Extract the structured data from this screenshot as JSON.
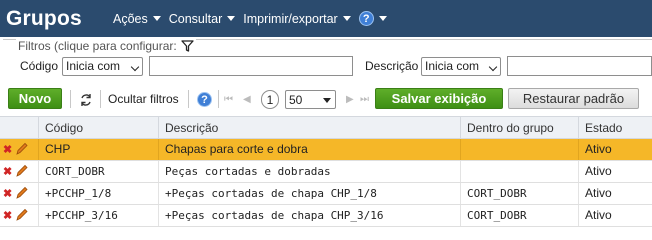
{
  "header": {
    "title": "Grupos",
    "menu": [
      {
        "label": "Ações"
      },
      {
        "label": "Consultar"
      },
      {
        "label": "Imprimir/exportar"
      }
    ],
    "help_icon": "?",
    "background_color": "#2b4b6e"
  },
  "filters": {
    "legend": "Filtros (clique para configurar:",
    "codigo_label": "Código",
    "codigo_operator": "Inicia com",
    "codigo_value": "",
    "descricao_label": "Descrição",
    "descricao_operator": "Inicia com",
    "descricao_value": ""
  },
  "toolbar": {
    "new_label": "Novo",
    "hide_filters_label": "Ocultar filtros",
    "help_icon": "?",
    "page_number": "1",
    "page_size": "50",
    "save_view_label": "Salvar exibição",
    "restore_default_label": "Restaurar padrão"
  },
  "table": {
    "columns": [
      "Código",
      "Descrição",
      "Dentro do grupo",
      "Estado"
    ],
    "rows": [
      {
        "codigo": "CHP",
        "descricao": "Chapas para corte e dobra",
        "dentro_do_grupo": "",
        "estado": "Ativo",
        "selected": true
      },
      {
        "codigo": "CORT_DOBR",
        "descricao": "Peças cortadas e dobradas",
        "dentro_do_grupo": "",
        "estado": "Ativo",
        "selected": false
      },
      {
        "codigo": "+PCCHP_1/8",
        "descricao": "+Peças cortadas de chapa CHP_1/8",
        "dentro_do_grupo": "CORT_DOBR",
        "estado": "Ativo",
        "selected": false
      },
      {
        "codigo": "+PCCHP_3/16",
        "descricao": "+Peças cortadas de chapa CHP_3/16",
        "dentro_do_grupo": "CORT_DOBR",
        "estado": "Ativo",
        "selected": false
      }
    ]
  },
  "colors": {
    "selected_row": "#f5b728",
    "accent_green": "#4a9c1e",
    "delete_icon": "#d02525",
    "edit_icon": "#e07a1c"
  }
}
